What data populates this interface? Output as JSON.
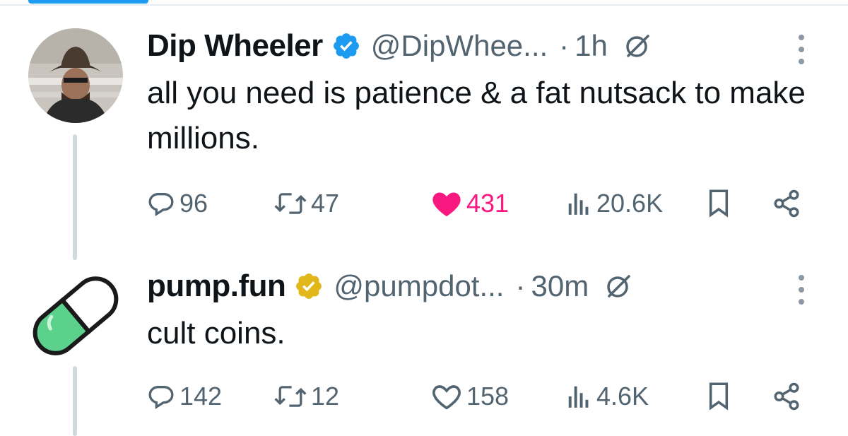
{
  "tweets": [
    {
      "name": "Dip Wheeler",
      "handle": "@DipWhee...",
      "separator": "·",
      "time": "1h",
      "verified": "blue",
      "text": "all you need is patience & a fat nutsack to make millions.",
      "avatar": "person-in-cowboy-hat",
      "liked": true,
      "stats": {
        "replies": "96",
        "reposts": "47",
        "likes": "431",
        "views": "20.6K"
      }
    },
    {
      "name": "pump.fun",
      "handle": "@pumpdot...",
      "separator": "·",
      "time": "30m",
      "verified": "gold",
      "text": "cult coins.",
      "avatar": "green-white-pill",
      "liked": false,
      "stats": {
        "replies": "142",
        "reposts": "12",
        "likes": "158",
        "views": "4.6K"
      }
    }
  ],
  "colors": {
    "blue_badge": "#1d9bf0",
    "gold_badge": "#e2b719",
    "like_active": "#f91880",
    "muted": "#536471",
    "thread_line": "#cfd9de"
  }
}
